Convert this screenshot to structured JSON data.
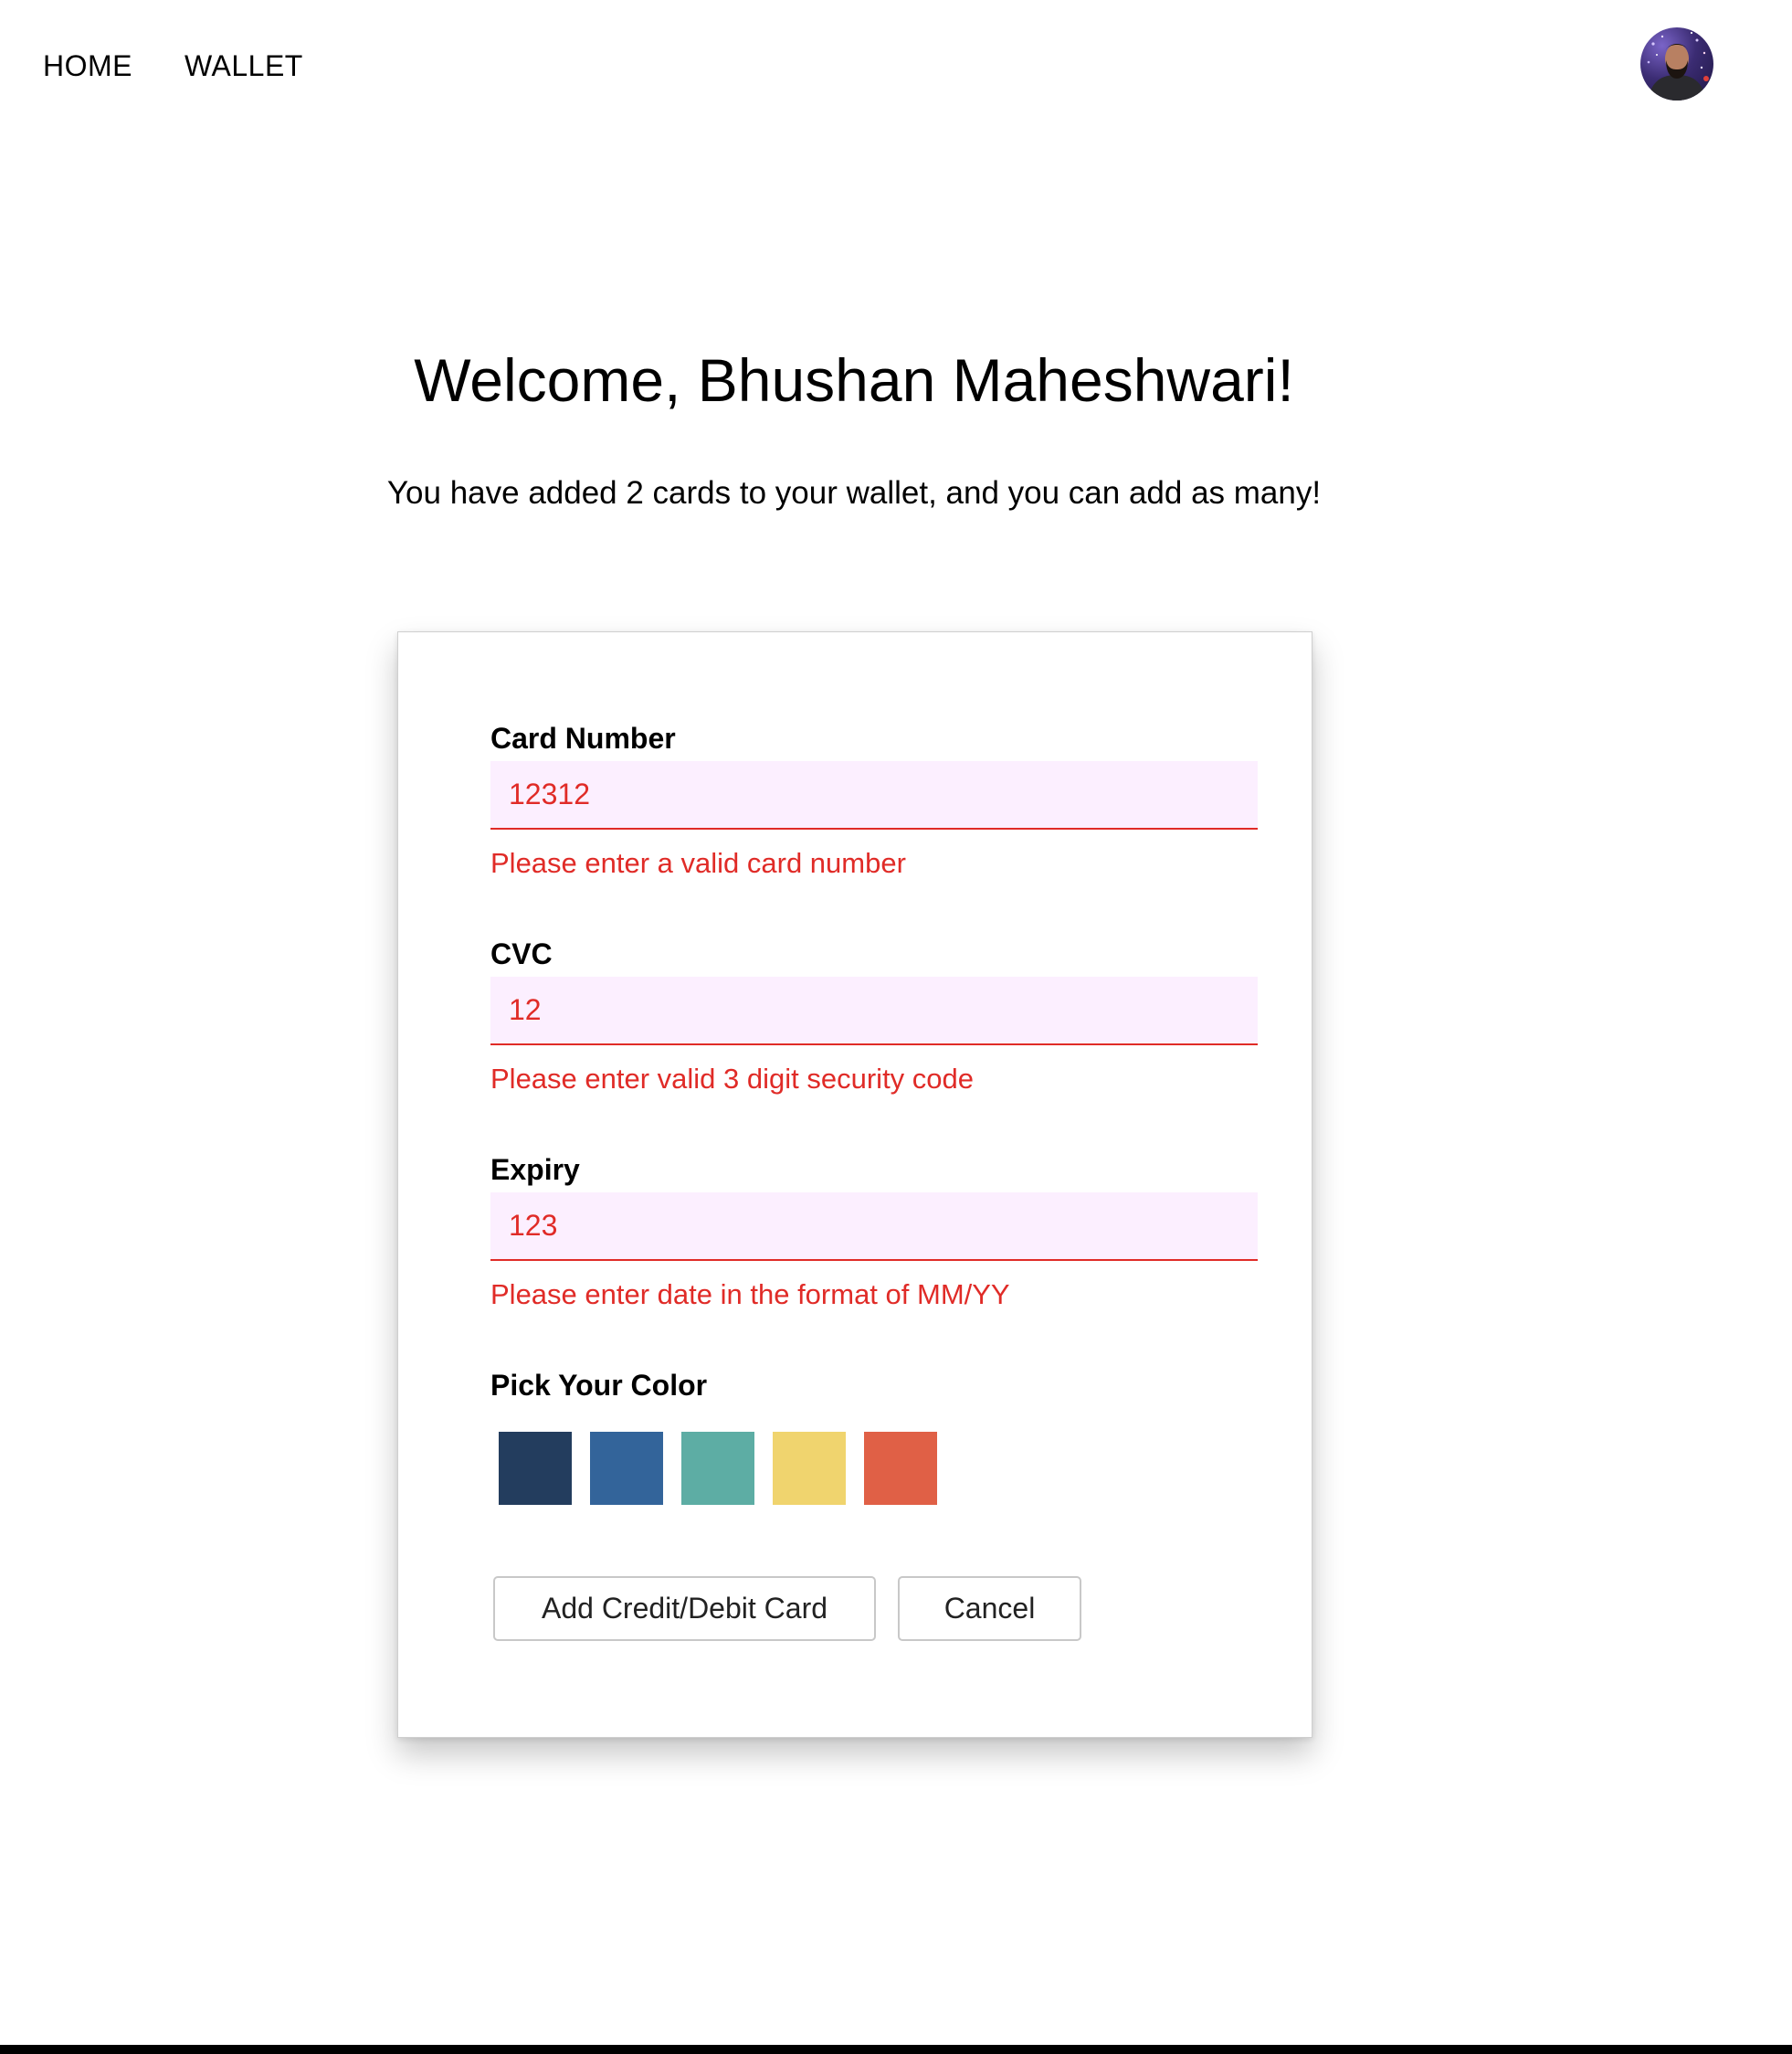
{
  "nav": {
    "home_label": "HOME",
    "wallet_label": "WALLET"
  },
  "header": {
    "welcome": "Welcome, Bhushan Maheshwari!",
    "subtitle": "You have added 2 cards to your wallet, and you can add as many!"
  },
  "form": {
    "card_number": {
      "label": "Card Number",
      "value": "12312",
      "error": "Please enter a valid card number"
    },
    "cvc": {
      "label": "CVC",
      "value": "12",
      "error": "Please enter valid 3 digit security code"
    },
    "expiry": {
      "label": "Expiry",
      "value": "123",
      "error": "Please enter date in the format of MM/YY"
    },
    "color_picker": {
      "label": "Pick Your Color",
      "colors": [
        "#233d5e",
        "#33649a",
        "#5dada4",
        "#f0d46e",
        "#e06046"
      ]
    },
    "add_button_label": "Add Credit/Debit Card",
    "cancel_button_label": "Cancel"
  },
  "theme": {
    "error_color": "#e02b27",
    "input_background": "#fcefff"
  }
}
